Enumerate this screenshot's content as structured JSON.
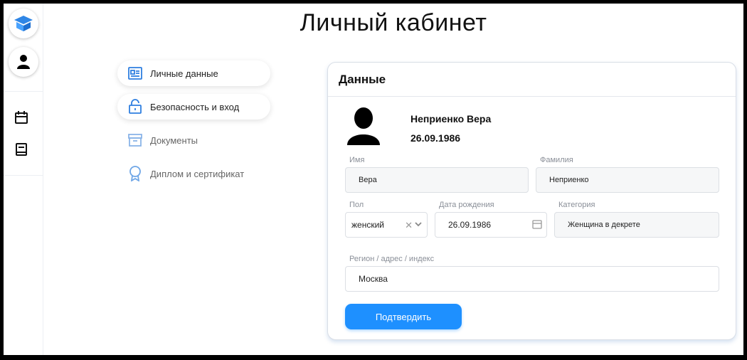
{
  "page": {
    "title": "Личный кабинет"
  },
  "menu": {
    "items": [
      {
        "label": "Личные данные",
        "icon": "id-card-icon",
        "active": true
      },
      {
        "label": "Безопасность и вход",
        "icon": "unlock-icon",
        "active": true
      },
      {
        "label": "Документы",
        "icon": "archive-icon",
        "active": false
      },
      {
        "label": "Диплом и сертификат",
        "icon": "award-icon",
        "active": false
      }
    ]
  },
  "card": {
    "title": "Данные",
    "profile": {
      "name": "Неприенко Вера",
      "birthdate": "26.09.1986"
    },
    "fields": {
      "first_name": {
        "label": "Имя",
        "value": "Вера"
      },
      "last_name": {
        "label": "Фамилия",
        "value": "Неприенко"
      },
      "gender": {
        "label": "Пол",
        "value": "женский"
      },
      "birthdate": {
        "label": "Дата рождения",
        "value": "26.09.1986"
      },
      "category": {
        "label": "Категория",
        "value": "Женщина в декрете"
      },
      "region": {
        "label": "Регион / адрес / индекс",
        "value": "Москва"
      }
    },
    "confirm_label": "Подтвердить"
  },
  "colors": {
    "accent": "#1e90ff",
    "icon_blue": "#4a90e2",
    "menu_muted_icon": "#8ab4e8"
  }
}
